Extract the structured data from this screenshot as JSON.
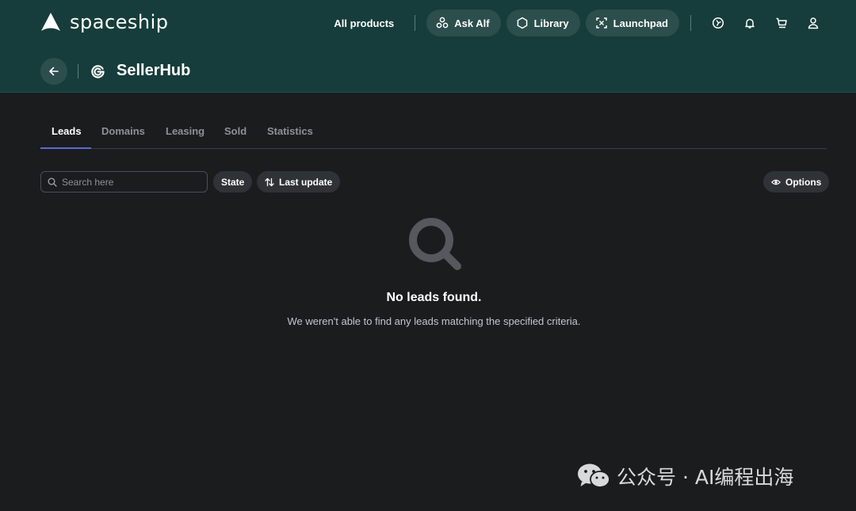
{
  "brand": {
    "name": "spaceship"
  },
  "nav": {
    "all_products": "All products",
    "ask_alf": "Ask Alf",
    "library": "Library",
    "launchpad": "Launchpad",
    "icons": [
      "compass-icon",
      "bell-icon",
      "cart-icon",
      "user-icon"
    ]
  },
  "page": {
    "title": "SellerHub"
  },
  "tabs": [
    {
      "label": "Leads",
      "active": true
    },
    {
      "label": "Domains",
      "active": false
    },
    {
      "label": "Leasing",
      "active": false
    },
    {
      "label": "Sold",
      "active": false
    },
    {
      "label": "Statistics",
      "active": false
    }
  ],
  "toolbar": {
    "search_placeholder": "Search here",
    "state_label": "State",
    "sort_label": "Last update",
    "options_label": "Options"
  },
  "empty_state": {
    "title": "No leads found.",
    "description": "We weren't able to find any leads matching the specified criteria."
  },
  "watermark": {
    "text": "公众号 · AI编程出海"
  },
  "colors": {
    "header_bg": "#163d3b",
    "page_bg": "#1b1c1e",
    "pill_bg": "#2c4e4c",
    "tab_accent": "#5b6ad6"
  }
}
